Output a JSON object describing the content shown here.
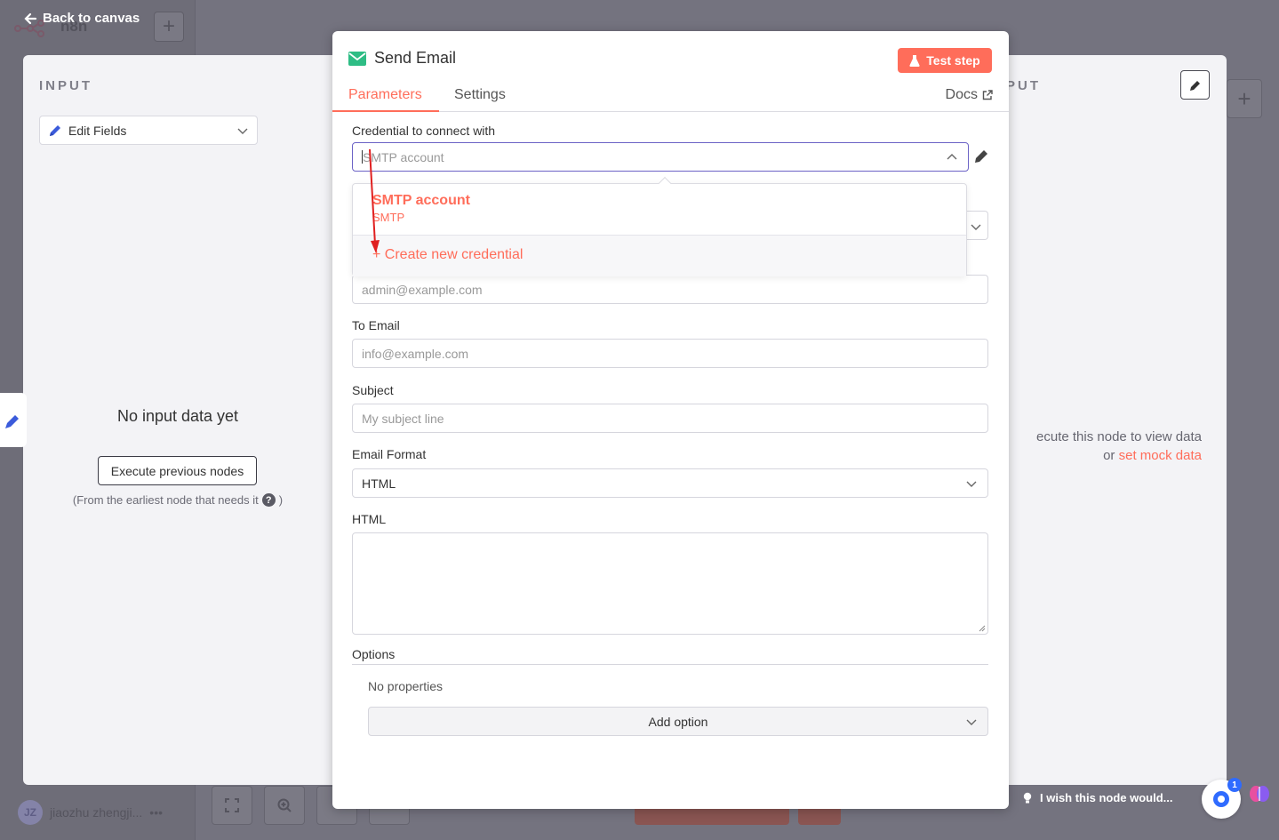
{
  "canvas": {
    "back_label": "Back to canvas",
    "brand": "n8n",
    "user_initials": "JZ",
    "user_name": "jiaozhu zhengji...",
    "wish_text": "I wish this node would...",
    "chat_badge": "1"
  },
  "input_panel": {
    "label": "INPUT",
    "node_select": "Edit Fields",
    "empty_title": "No input data yet",
    "execute_button": "Execute previous nodes",
    "hint": "(From the earliest node that needs it",
    "hint_close": ")"
  },
  "output_panel": {
    "label": "PUT",
    "message_line1": "ecute this node to view data",
    "message_or": "or",
    "mock_link": "set mock data"
  },
  "node": {
    "title": "Send Email",
    "test_button": "Test step",
    "tabs": [
      {
        "label": "Parameters",
        "active": true
      },
      {
        "label": "Settings",
        "active": false
      }
    ],
    "docs_label": "Docs",
    "accent_color": "#ff6d5a",
    "fields": {
      "credential_label": "Credential to connect with",
      "credential_placeholder": "SMTP account",
      "from_placeholder": "admin@example.com",
      "to_label": "To Email",
      "to_placeholder": "info@example.com",
      "subject_label": "Subject",
      "subject_placeholder": "My subject line",
      "format_label": "Email Format",
      "format_value": "HTML",
      "html_label": "HTML",
      "options_label": "Options",
      "no_properties": "No properties",
      "add_option": "Add option"
    },
    "credential_dropdown": {
      "items": [
        {
          "name": "SMTP account",
          "type": "SMTP"
        }
      ],
      "create_new": "Create new credential"
    }
  }
}
